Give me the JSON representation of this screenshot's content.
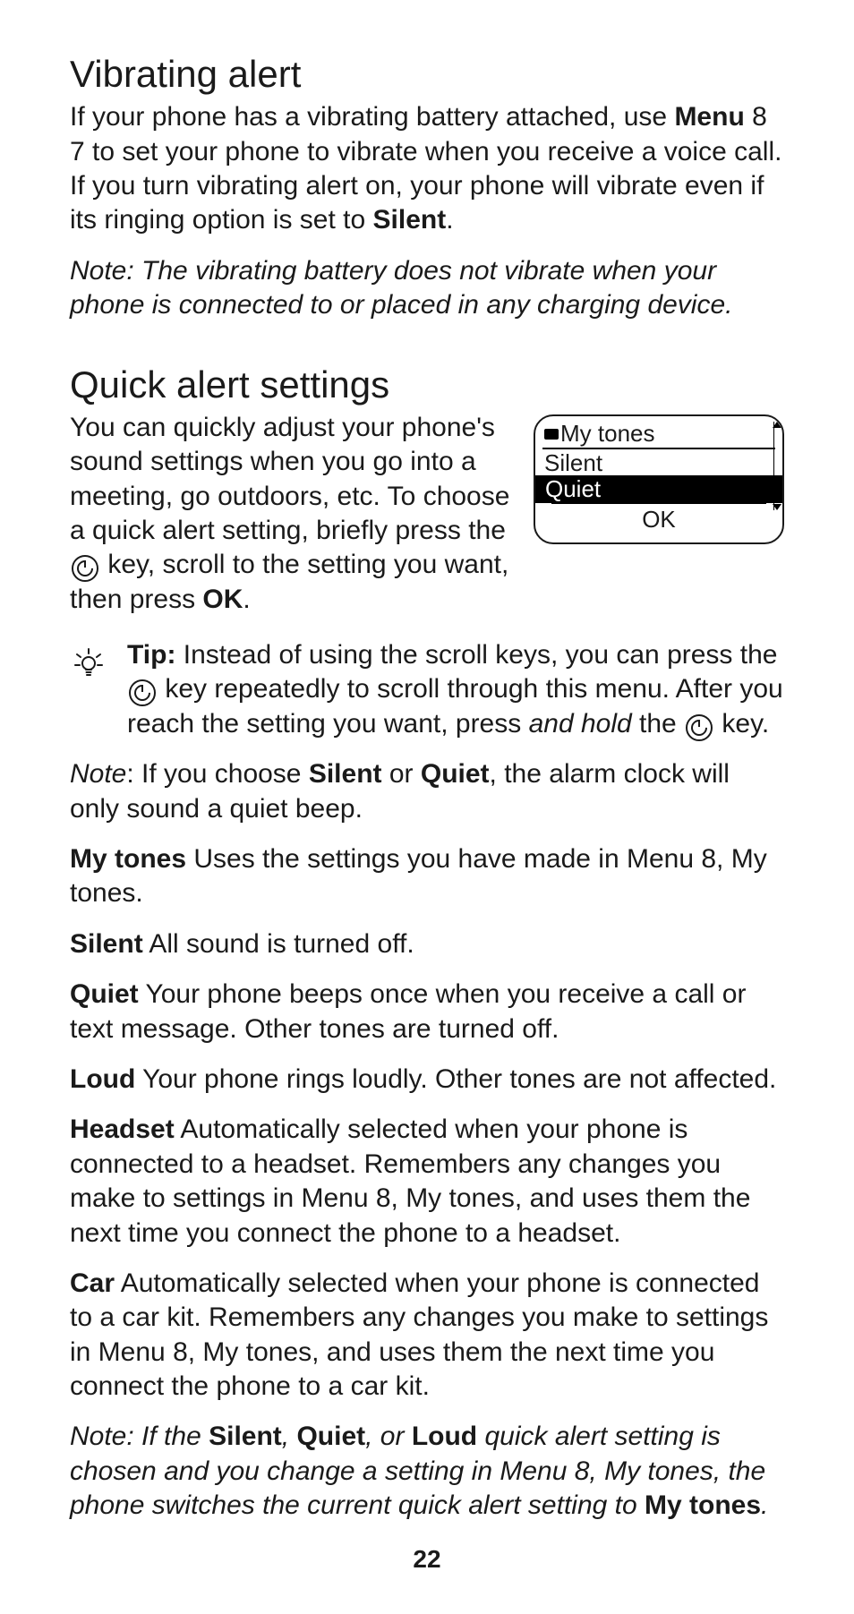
{
  "section1": {
    "title": "Vibrating alert"
  },
  "para1": {
    "pre": "If your phone has a vibrating battery attached, use ",
    "menu": "Menu",
    "post1": " 8 7 to set your phone to vibrate when you receive a voice call. If you turn vibrating alert on, your phone will vibrate even if its ringing option is set to ",
    "silent": "Silent",
    "post2": "."
  },
  "note1": "Note:  The vibrating battery does not vibrate when your phone is connected to or placed in any charging device.",
  "section2": {
    "title": "Quick alert settings"
  },
  "quick_intro": {
    "pre": "You can quickly adjust your phone's sound settings when you go into a meeting, go outdoors, etc. To choose a quick alert setting, briefly press the ",
    "mid": " key, scroll to the setting you want, then press ",
    "ok": "OK",
    "post": "."
  },
  "screen": {
    "items": [
      "My tones",
      "Silent",
      "Quiet"
    ],
    "selected_index": 2,
    "soft_key": "OK"
  },
  "tip": {
    "label": "Tip:",
    "pre": "  Instead of using the scroll keys, you can press the ",
    "mid1": " key repeatedly to scroll through this menu. After you reach the setting you want, press ",
    "hold": "and hold",
    "mid2": " the ",
    "post": " key."
  },
  "note2": {
    "label": "Note",
    "pre": ":  If you choose ",
    "s": "Silent",
    "or": " or ",
    "q": "Quiet",
    "post": ", the alarm clock will only sound a quiet beep."
  },
  "defs": {
    "my_tones": {
      "label": "My tones",
      "text": "  Uses the settings you have made in Menu 8, My tones."
    },
    "silent": {
      "label": "Silent",
      "text": "  All sound is turned off."
    },
    "quiet": {
      "label": "Quiet",
      "text": "  Your phone beeps once when you receive a call or text message. Other tones are turned off."
    },
    "loud": {
      "label": "Loud",
      "text": "  Your phone rings loudly. Other tones are not affected."
    },
    "headset": {
      "label": "Headset",
      "text": "  Automatically selected when your phone is connected to a headset. Remembers any changes you make to settings in Menu 8, My tones, and uses them the next time you connect the phone to a headset."
    },
    "car": {
      "label": "Car",
      "text": "  Automatically selected when your phone is connected to a car kit. Remembers any changes you make to settings in Menu 8, My tones, and uses them the next time you connect the phone to a car kit."
    }
  },
  "note3": {
    "pre": "Note:  If the ",
    "s": "Silent",
    "c1": ", ",
    "q": "Quiet",
    "c2": ", or ",
    "l": "Loud",
    "mid": " quick alert setting is chosen and you change a setting in Menu 8, My tones, the phone switches the current quick alert setting to ",
    "mt": "My tones",
    "post": "."
  },
  "page_number": "22"
}
